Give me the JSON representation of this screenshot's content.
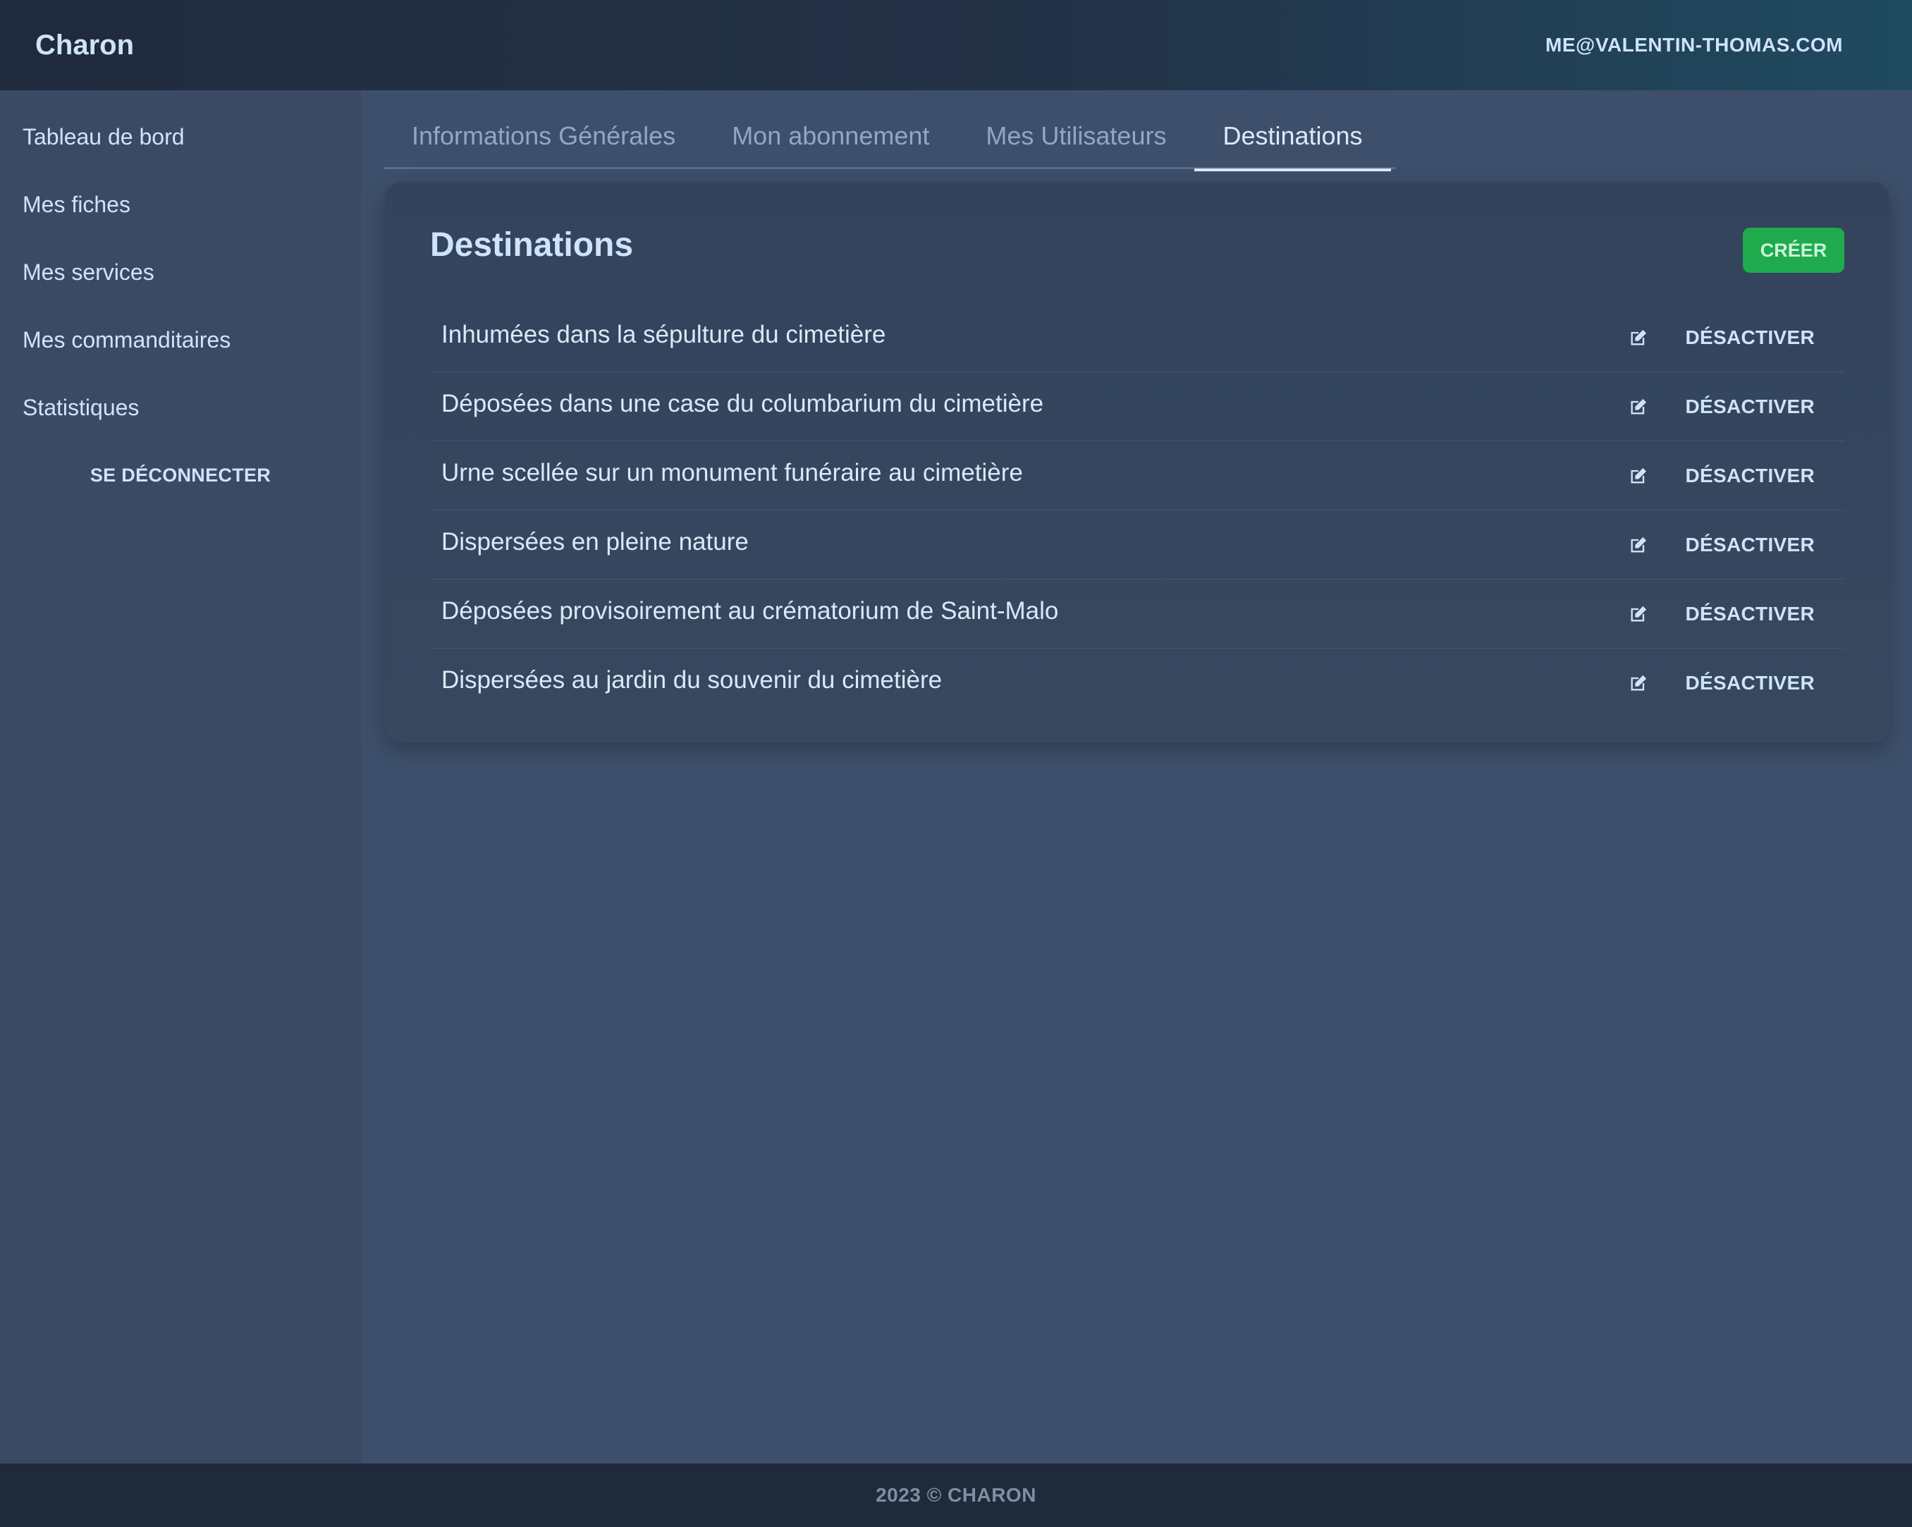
{
  "header": {
    "brand": "Charon",
    "user_email": "ME@VALENTIN-THOMAS.COM"
  },
  "sidebar": {
    "items": [
      {
        "label": "Tableau de bord"
      },
      {
        "label": "Mes fiches"
      },
      {
        "label": "Mes services"
      },
      {
        "label": "Mes commanditaires"
      },
      {
        "label": "Statistiques"
      }
    ],
    "logout_label": "SE DÉCONNECTER"
  },
  "tabs": [
    {
      "label": "Informations Générales",
      "active": false
    },
    {
      "label": "Mon abonnement",
      "active": false
    },
    {
      "label": "Mes Utilisateurs",
      "active": false
    },
    {
      "label": "Destinations",
      "active": true
    }
  ],
  "card": {
    "title": "Destinations",
    "create_label": "CRÉER",
    "deactivate_label": "DÉSACTIVER",
    "edit_icon": "edit-icon",
    "items": [
      {
        "label": "Inhumées dans la sépulture du cimetière"
      },
      {
        "label": "Déposées dans une case du columbarium du cimetière"
      },
      {
        "label": "Urne scellée sur un monument funéraire au cimetière"
      },
      {
        "label": "Dispersées en pleine nature"
      },
      {
        "label": "Déposées provisoirement au crématorium de Saint-Malo"
      },
      {
        "label": "Dispersées au jardin du souvenir du cimetière"
      }
    ]
  },
  "footer": {
    "text": "2023 © CHARON"
  },
  "colors": {
    "accent_green": "#1faa4e",
    "background": "#3d4f6b",
    "header": "#1f2a3d"
  }
}
